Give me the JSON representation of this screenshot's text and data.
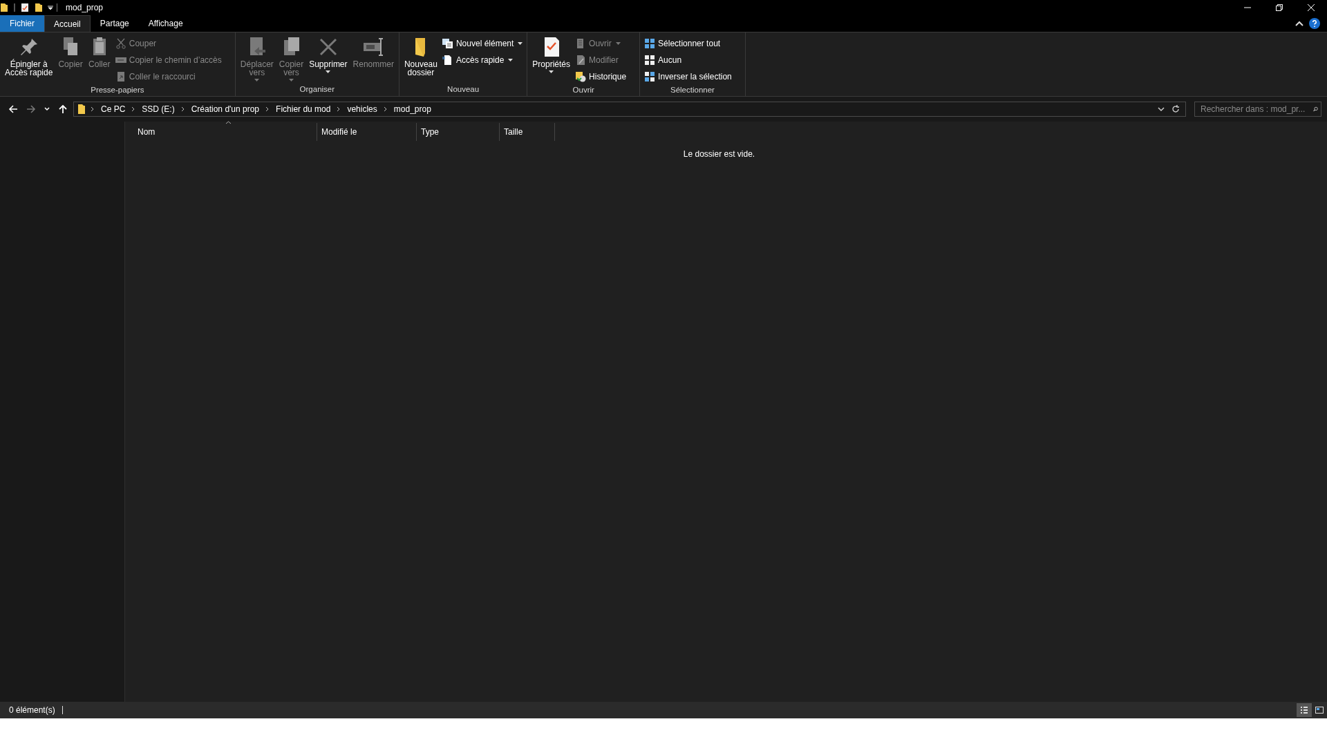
{
  "window": {
    "title": "mod_prop"
  },
  "tabs": [
    {
      "label": "Fichier",
      "kind": "file",
      "selected": false
    },
    {
      "label": "Accueil",
      "kind": "tab",
      "selected": true
    },
    {
      "label": "Partage",
      "kind": "tab",
      "selected": false
    },
    {
      "label": "Affichage",
      "kind": "tab",
      "selected": false
    }
  ],
  "ribbon": [
    {
      "label": "Presse-papiers",
      "columns": [
        [
          {
            "kind": "large",
            "lines": [
              "Épingler à",
              "Accès rapide"
            ],
            "disabled": false,
            "dropdown": false
          }
        ],
        [
          {
            "kind": "large",
            "lines": [
              "Copier"
            ],
            "disabled": true,
            "dropdown": false
          }
        ],
        [
          {
            "kind": "large",
            "lines": [
              "Coller"
            ],
            "disabled": true,
            "dropdown": false
          }
        ],
        [
          {
            "kind": "small",
            "lines": [
              "Couper"
            ],
            "disabled": true,
            "dropdown": false
          },
          {
            "kind": "small",
            "lines": [
              "Copier le chemin d’accès"
            ],
            "disabled": true,
            "dropdown": false
          },
          {
            "kind": "small",
            "lines": [
              "Coller le raccourci"
            ],
            "disabled": true,
            "dropdown": false
          }
        ]
      ]
    },
    {
      "label": "Organiser",
      "columns": [
        [
          {
            "kind": "large",
            "lines": [
              "Déplacer",
              "vers"
            ],
            "disabled": true,
            "dropdown": true
          }
        ],
        [
          {
            "kind": "large",
            "lines": [
              "Copier",
              "vers"
            ],
            "disabled": true,
            "dropdown": true
          }
        ],
        [
          {
            "kind": "large",
            "lines": [
              "Supprimer"
            ],
            "disabled": false,
            "dropdown": true
          }
        ],
        [
          {
            "kind": "large",
            "lines": [
              "Renommer"
            ],
            "disabled": true,
            "dropdown": false
          }
        ]
      ]
    },
    {
      "label": "Nouveau",
      "columns": [
        [
          {
            "kind": "large",
            "lines": [
              "Nouveau",
              "dossier"
            ],
            "disabled": false,
            "dropdown": false
          }
        ],
        [
          {
            "kind": "small",
            "lines": [
              "Nouvel élément"
            ],
            "disabled": false,
            "dropdown": true
          },
          {
            "kind": "small",
            "lines": [
              "Accès rapide"
            ],
            "disabled": false,
            "dropdown": true
          }
        ]
      ]
    },
    {
      "label": "Ouvrir",
      "columns": [
        [
          {
            "kind": "large",
            "lines": [
              "Propriétés"
            ],
            "disabled": false,
            "dropdown": true
          }
        ],
        [
          {
            "kind": "small",
            "lines": [
              "Ouvrir"
            ],
            "disabled": true,
            "dropdown": true
          },
          {
            "kind": "small",
            "lines": [
              "Modifier"
            ],
            "disabled": true,
            "dropdown": false
          },
          {
            "kind": "small",
            "lines": [
              "Historique"
            ],
            "disabled": false,
            "dropdown": false
          }
        ]
      ]
    },
    {
      "label": "Sélectionner",
      "columns": [
        [
          {
            "kind": "small",
            "lines": [
              "Sélectionner tout"
            ],
            "disabled": false,
            "dropdown": false
          },
          {
            "kind": "small",
            "lines": [
              "Aucun"
            ],
            "disabled": false,
            "dropdown": false
          },
          {
            "kind": "small",
            "lines": [
              "Inverser la sélection"
            ],
            "disabled": false,
            "dropdown": false
          }
        ]
      ]
    }
  ],
  "navigation": {
    "back_disabled": false,
    "forward_disabled": true
  },
  "breadcrumbs": [
    "Ce PC",
    "SSD (E:)",
    "Création d'un prop",
    "Fichier du mod",
    "vehicles",
    "mod_prop"
  ],
  "search": {
    "placeholder": "Rechercher dans : mod_pr..."
  },
  "columns": [
    {
      "label": "Nom",
      "sorted": true
    },
    {
      "label": "Modifié le",
      "sorted": false
    },
    {
      "label": "Type",
      "sorted": false
    },
    {
      "label": "Taille",
      "sorted": false
    }
  ],
  "empty_message": "Le dossier est vide.",
  "status_bar": {
    "text": "0 élément(s)",
    "views": [
      {
        "kind": "details",
        "selected": true
      },
      {
        "kind": "tiles",
        "selected": false
      }
    ]
  }
}
